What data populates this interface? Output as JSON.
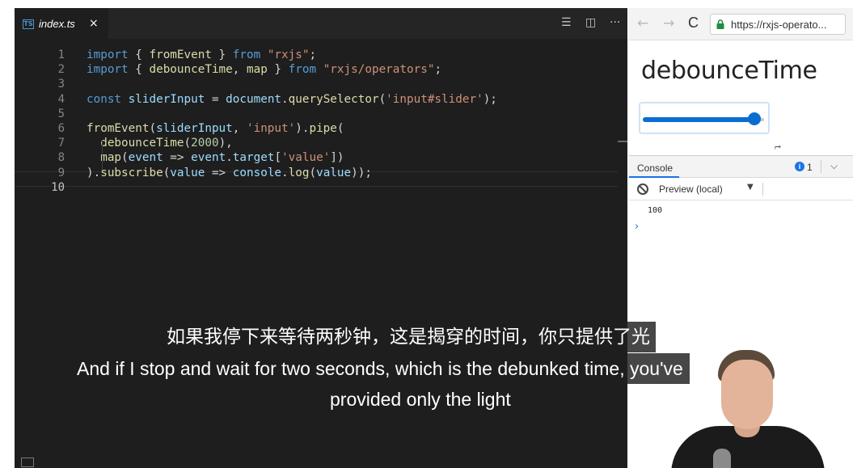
{
  "editor": {
    "tab": {
      "icon_text": "TS",
      "filename": "index.ts",
      "close": "×"
    },
    "actions": {
      "split_lines": "☰",
      "split_editor": "◫",
      "more": "···"
    },
    "line_numbers": [
      "1",
      "2",
      "3",
      "4",
      "5",
      "6",
      "7",
      "8",
      "9",
      "10"
    ],
    "current_line": 10,
    "code": [
      [
        {
          "t": "import",
          "c": "kw"
        },
        {
          "t": " { ",
          "c": ""
        },
        {
          "t": "fromEvent",
          "c": "fn"
        },
        {
          "t": " } ",
          "c": ""
        },
        {
          "t": "from",
          "c": "kw"
        },
        {
          "t": " ",
          "c": ""
        },
        {
          "t": "\"rxjs\"",
          "c": "str"
        },
        {
          "t": ";",
          "c": ""
        }
      ],
      [
        {
          "t": "import",
          "c": "kw"
        },
        {
          "t": " { ",
          "c": ""
        },
        {
          "t": "debounceTime",
          "c": "fn"
        },
        {
          "t": ", ",
          "c": ""
        },
        {
          "t": "map",
          "c": "fn"
        },
        {
          "t": " } ",
          "c": ""
        },
        {
          "t": "from",
          "c": "kw"
        },
        {
          "t": " ",
          "c": ""
        },
        {
          "t": "\"rxjs/operators\"",
          "c": "str"
        },
        {
          "t": ";",
          "c": ""
        }
      ],
      [],
      [
        {
          "t": "const",
          "c": "kw"
        },
        {
          "t": " ",
          "c": ""
        },
        {
          "t": "sliderInput",
          "c": "var"
        },
        {
          "t": " = ",
          "c": ""
        },
        {
          "t": "document",
          "c": "var"
        },
        {
          "t": ".",
          "c": ""
        },
        {
          "t": "querySelector",
          "c": "fn"
        },
        {
          "t": "(",
          "c": ""
        },
        {
          "t": "'input#slider'",
          "c": "str"
        },
        {
          "t": ");",
          "c": ""
        }
      ],
      [],
      [
        {
          "t": "fromEvent",
          "c": "fn"
        },
        {
          "t": "(",
          "c": ""
        },
        {
          "t": "sliderInput",
          "c": "var"
        },
        {
          "t": ", ",
          "c": ""
        },
        {
          "t": "'input'",
          "c": "str"
        },
        {
          "t": ").",
          "c": ""
        },
        {
          "t": "pipe",
          "c": "fn"
        },
        {
          "t": "(",
          "c": ""
        }
      ],
      [
        {
          "t": "  ",
          "c": ""
        },
        {
          "t": "debounceTime",
          "c": "fn"
        },
        {
          "t": "(",
          "c": ""
        },
        {
          "t": "2000",
          "c": "num"
        },
        {
          "t": "),",
          "c": ""
        }
      ],
      [
        {
          "t": "  ",
          "c": ""
        },
        {
          "t": "map",
          "c": "fn"
        },
        {
          "t": "(",
          "c": ""
        },
        {
          "t": "event",
          "c": "var"
        },
        {
          "t": " => ",
          "c": ""
        },
        {
          "t": "event",
          "c": "var"
        },
        {
          "t": ".",
          "c": ""
        },
        {
          "t": "target",
          "c": "var"
        },
        {
          "t": "[",
          "c": ""
        },
        {
          "t": "'value'",
          "c": "str"
        },
        {
          "t": "])",
          "c": ""
        }
      ],
      [
        {
          "t": ").",
          "c": ""
        },
        {
          "t": "subscribe",
          "c": "fn"
        },
        {
          "t": "(",
          "c": ""
        },
        {
          "t": "value",
          "c": "var"
        },
        {
          "t": " => ",
          "c": ""
        },
        {
          "t": "console",
          "c": "var"
        },
        {
          "t": ".",
          "c": ""
        },
        {
          "t": "log",
          "c": "fn"
        },
        {
          "t": "(",
          "c": ""
        },
        {
          "t": "value",
          "c": "var"
        },
        {
          "t": "));",
          "c": ""
        }
      ],
      []
    ],
    "colors": {
      "background": "#1e1e1e",
      "keyword": "#569cd6",
      "function": "#dcdcaa",
      "string": "#ce9178",
      "number": "#b5cea8",
      "variable": "#9cdcfe"
    }
  },
  "browser": {
    "nav": {
      "back": "←",
      "forward": "→",
      "reload": "C",
      "lock_icon": "lock-icon"
    },
    "url": "https://rxjs-operato...",
    "page_title": "debounceTime",
    "slider": {
      "value_fraction": 0.92,
      "accent": "#0a6ed1"
    },
    "devtools": {
      "tab": "Console",
      "info_badge": "i",
      "message_count": "1",
      "menu": "⌵",
      "context": "Preview (local)",
      "context_caret": "▼",
      "log": "100",
      "prompt": "›"
    }
  },
  "subtitles": {
    "zh": "如果我停下来等待两秒钟，这是揭穿的时间，你只提供了光",
    "en_line1": "And if I stop and wait for two seconds, which is the debunked time, you've",
    "en_line2": "provided only the light"
  }
}
